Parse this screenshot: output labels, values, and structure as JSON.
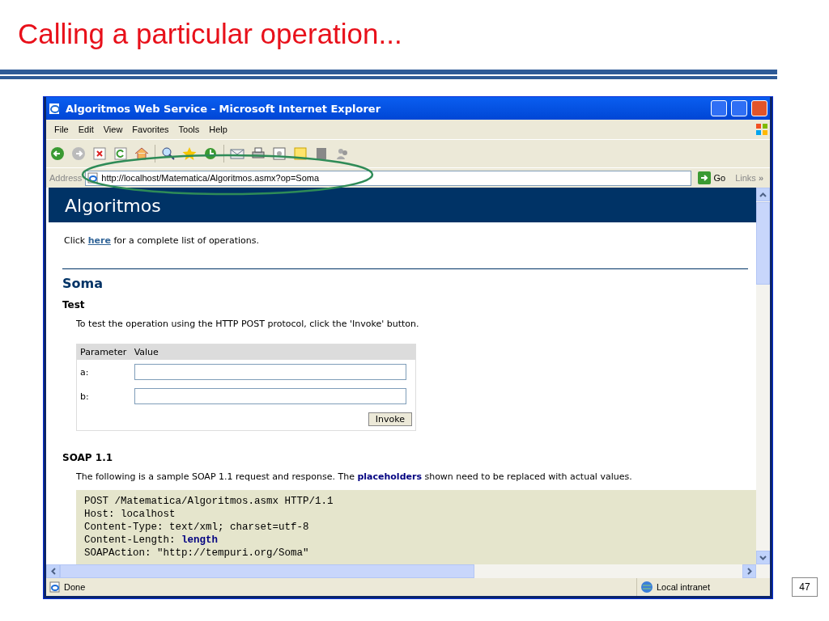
{
  "slide": {
    "title": "Calling a particular operation...",
    "page_number": "47"
  },
  "window": {
    "title": "Algoritmos Web Service - Microsoft Internet Explorer"
  },
  "menu": [
    "File",
    "Edit",
    "View",
    "Favorites",
    "Tools",
    "Help"
  ],
  "address_bar": {
    "label": "Address",
    "value": "http://localhost/Matematica/Algoritmos.asmx?op=Soma",
    "go": "Go",
    "links": "Links",
    "links_chevron": "»"
  },
  "page": {
    "header": "Algoritmos",
    "intro": {
      "before": "Click ",
      "link": "here",
      "after": " for a complete list of operations."
    },
    "operation": "Soma",
    "test": {
      "heading": "Test",
      "text": "To test the operation using the HTTP POST protocol, click the 'Invoke' button.",
      "columns": [
        "Parameter",
        "Value"
      ],
      "rows": [
        {
          "label": "a:"
        },
        {
          "label": "b:"
        }
      ],
      "button": "Invoke"
    },
    "soap": {
      "heading": "SOAP 1.1",
      "text": {
        "before": "The following is a sample SOAP 1.1 request and response. The ",
        "link": "placeholders",
        "after": " shown need to be replaced with actual values."
      },
      "code": [
        [
          {
            "text": "POST /Matematica/Algoritmos.asmx HTTP/1.1"
          }
        ],
        [
          {
            "text": "Host: localhost"
          }
        ],
        [
          {
            "text": "Content-Type: text/xml; charset=utf-8"
          }
        ],
        [
          {
            "text": "Content-Length: "
          },
          {
            "text": "length",
            "kind": "placeholder"
          }
        ],
        [
          {
            "text": "SOAPAction: \"http://tempuri.org/Soma\""
          }
        ]
      ]
    }
  },
  "status_bar": {
    "text": "Done",
    "zone": "Local intranet"
  }
}
